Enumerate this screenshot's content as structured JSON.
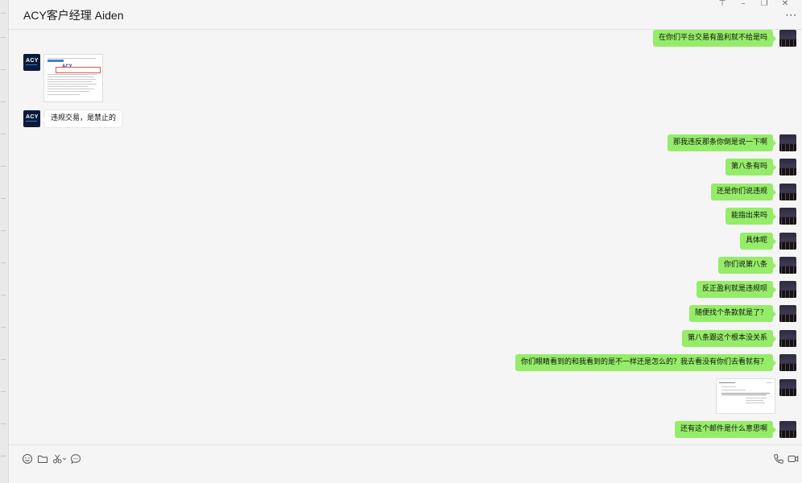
{
  "window": {
    "title": "ACY客户经理  Aiden",
    "controls": [
      "pin-icon",
      "minimize-icon",
      "maximize-icon",
      "close-icon"
    ]
  },
  "messages": [
    {
      "from": "me",
      "type": "text",
      "text": "在你们平台交易有盈利就不给是吗"
    },
    {
      "from": "them",
      "type": "image",
      "image": "screenshot-document"
    },
    {
      "from": "them",
      "type": "text",
      "text": "违规交易，是禁止的"
    },
    {
      "from": "me",
      "type": "text",
      "text": "那我违反那条你倒是说一下啊"
    },
    {
      "from": "me",
      "type": "text",
      "text": "第八条有吗"
    },
    {
      "from": "me",
      "type": "text",
      "text": "还是你们说违规"
    },
    {
      "from": "me",
      "type": "text",
      "text": "能指出来吗"
    },
    {
      "from": "me",
      "type": "text",
      "text": "具体呢"
    },
    {
      "from": "me",
      "type": "text",
      "text": "你们说第八条"
    },
    {
      "from": "me",
      "type": "text",
      "text": "反正盈利就是违规呗"
    },
    {
      "from": "me",
      "type": "text",
      "text": "随便找个条款就是了？"
    },
    {
      "from": "me",
      "type": "text",
      "text": "第八条跟这个根本没关系"
    },
    {
      "from": "me",
      "type": "text",
      "text": "你们眼睛看到的和我看到的是不一样还是怎么的？我去看没有你们去看就有？"
    },
    {
      "from": "me",
      "type": "image",
      "image": "email-screenshot"
    },
    {
      "from": "me",
      "type": "text",
      "text": "还有这个邮件是什么意思啊"
    }
  ],
  "toolbar": {
    "icons": [
      "emoji-icon",
      "folder-icon",
      "scissors-icon",
      "chat-history-icon"
    ],
    "right_icons": [
      "phone-icon",
      "video-icon"
    ]
  },
  "colors": {
    "my_bubble": "#95ec69",
    "their_bubble": "#ffffff",
    "background": "#f5f5f5"
  }
}
